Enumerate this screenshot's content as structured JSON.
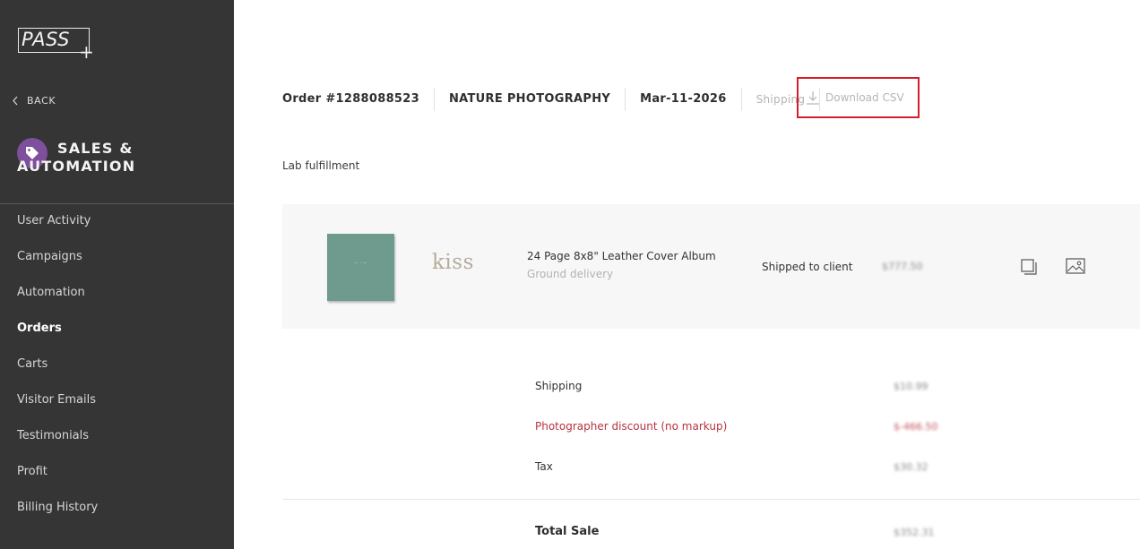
{
  "sidebar": {
    "logo_text": "PASS",
    "logo_plus": "+",
    "back_label": "BACK",
    "section_title_line1": "SALES &",
    "section_title_line2": "AUTOMATION",
    "section_icon": "tag-icon",
    "accent_color": "#7e4f9c",
    "items": [
      {
        "label": "User Activity"
      },
      {
        "label": "Campaigns"
      },
      {
        "label": "Automation"
      },
      {
        "label": "Orders",
        "active": true
      },
      {
        "label": "Carts"
      },
      {
        "label": "Visitor Emails"
      },
      {
        "label": "Testimonials"
      },
      {
        "label": "Profit"
      },
      {
        "label": "Billing History"
      }
    ]
  },
  "header": {
    "order_number": "Order #1288088523",
    "gallery_name": "NATURE PHOTOGRAPHY",
    "date": "Mar-11-2026",
    "shipping_label": "Shipping",
    "download_label": "Download CSV",
    "highlight_color": "#d31f2c"
  },
  "fulfillment": {
    "label": "Lab fulfillment"
  },
  "order_item": {
    "product_name": "24 Page 8x8\" Leather Cover Album",
    "delivery": "Ground delivery",
    "brand": "kiss",
    "status": "Shipped to client",
    "price": "$777.50",
    "album_color": "#6f9a8e"
  },
  "summary": {
    "shipping_label": "Shipping",
    "shipping_value": "$10.99",
    "discount_label": "Photographer discount (no markup)",
    "discount_value": "$-466.50",
    "tax_label": "Tax",
    "tax_value": "$30.32",
    "total_label": "Total Sale",
    "total_value": "$352.31"
  }
}
